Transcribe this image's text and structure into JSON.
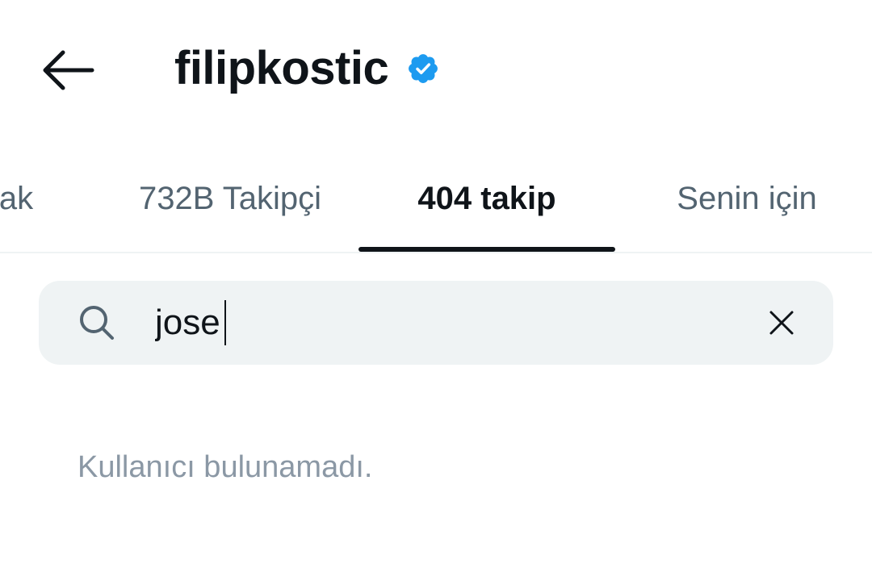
{
  "header": {
    "back_icon": "back-arrow-icon",
    "title": "filipkostic",
    "verified_icon": "verified-badge-icon",
    "verified_color": "#1d9bf0"
  },
  "tabs": [
    {
      "label": "ak",
      "active": false
    },
    {
      "label": "732B Takipçi",
      "active": false
    },
    {
      "label": "404 takip",
      "active": true
    },
    {
      "label": "Senin için",
      "active": false
    }
  ],
  "search": {
    "icon": "search-icon",
    "value": "jose",
    "clear_icon": "close-icon"
  },
  "results": {
    "empty_message": "Kullanıcı bulunamadı."
  },
  "colors": {
    "primary_text": "#0f1419",
    "secondary_text": "#536471",
    "muted_text": "#8b98a5",
    "search_bg": "#eff3f4"
  }
}
